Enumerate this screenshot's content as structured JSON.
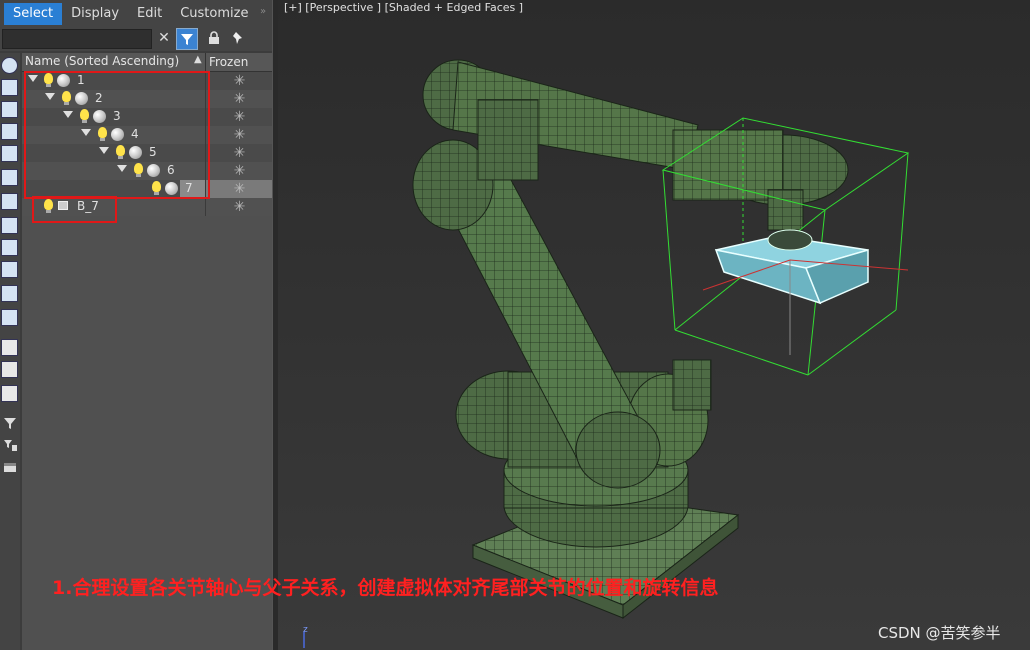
{
  "menu": {
    "select": "Select",
    "display": "Display",
    "edit": "Edit",
    "customize": "Customize"
  },
  "explorer": {
    "col_name": "Name (Sorted Ascending)",
    "col_frozen": "Frozen",
    "sort_icon": "triangle-up-icon",
    "frozen_icon": "snowflake-icon",
    "rows": [
      {
        "label": "1"
      },
      {
        "label": "2"
      },
      {
        "label": "3"
      },
      {
        "label": "4"
      },
      {
        "label": "5"
      },
      {
        "label": "6"
      },
      {
        "label": "7"
      },
      {
        "label": "B_7"
      }
    ]
  },
  "viewport": {
    "label": "[+] [Perspective ] [Shaded + Edged Faces ]"
  },
  "caption": "1.合理设置各关节轴心与父子关系，创建虚拟体对齐尾部关节的位置和旋转信息",
  "watermark": "CSDN @苦笑参半",
  "colors": {
    "menu_active": "#2a7fd4",
    "robot": "#4e6b45",
    "wire": "#1a2418",
    "helper_box": "#33dd33",
    "dummy": "#8fd3e0",
    "annotation": "#e01818"
  }
}
